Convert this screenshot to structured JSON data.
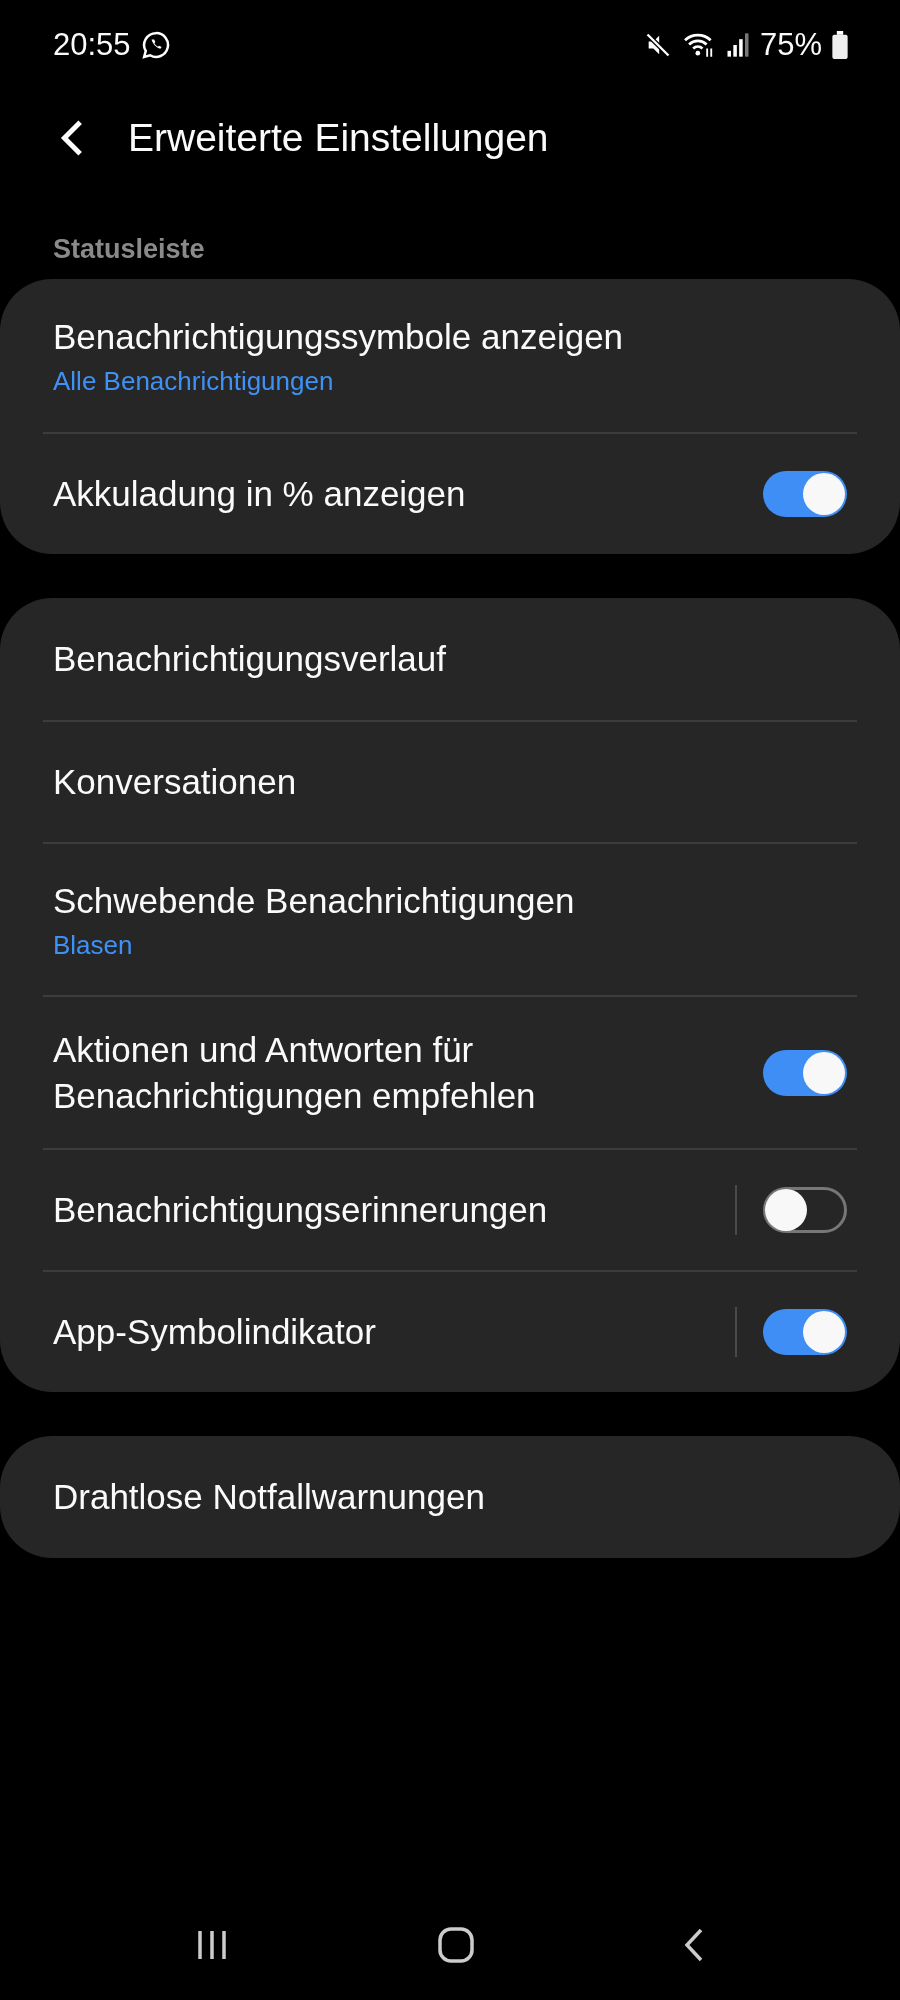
{
  "status_bar": {
    "time": "20:55",
    "battery": "75%"
  },
  "header": {
    "title": "Erweiterte Einstellungen"
  },
  "sections": [
    {
      "label": "Statusleiste",
      "items": [
        {
          "kind": "link",
          "title": "Benachrichtigungssymbole anzeigen",
          "subtitle": "Alle Benachrichtigungen"
        },
        {
          "kind": "switch",
          "title": "Akkuladung in % anzeigen",
          "on": true,
          "split": false
        }
      ]
    },
    {
      "items": [
        {
          "kind": "link",
          "title": "Benachrichtigungsverlauf"
        },
        {
          "kind": "link",
          "title": "Konversationen"
        },
        {
          "kind": "link",
          "title": "Schwebende Benachrichtigungen",
          "subtitle": "Blasen"
        },
        {
          "kind": "switch",
          "title": "Aktionen und Antworten für Benachrichtigungen empfehlen",
          "on": true,
          "split": false
        },
        {
          "kind": "switch",
          "title": "Benachrichtigungserinnerungen",
          "on": false,
          "split": true
        },
        {
          "kind": "switch",
          "title": "App-Symbolindikator",
          "on": true,
          "split": true
        }
      ]
    },
    {
      "items": [
        {
          "kind": "link",
          "title": "Drahtlose Notfallwarnungen"
        }
      ]
    }
  ]
}
